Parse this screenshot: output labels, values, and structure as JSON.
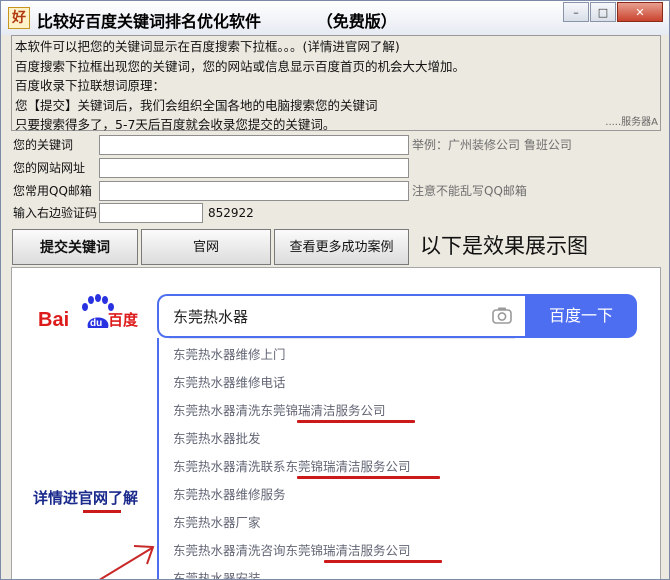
{
  "window": {
    "app_icon_char": "好",
    "title": "比较好百度关键词排名优化软件          （免费版）",
    "controls": {
      "minimize": "–",
      "maximize": "□",
      "close": "✕"
    }
  },
  "info": {
    "lines": [
      "本软件可以把您的关键词显示在百度搜索下拉框。。。(详情进官网了解)",
      "百度搜索下拉框出现您的关键词，您的网站或信息显示百度首页的机会大大增加。",
      "百度收录下拉联想词原理：",
      "您【提交】关键词后，我们会组织全国各地的电脑搜索您的关键词",
      "只要搜索得多了，5-7天后百度就会收录您提交的关键词。"
    ],
    "server_label": ".....服务器A"
  },
  "form": {
    "keyword_label": "您的关键词",
    "keyword_hint": "举例：广州装修公司 鲁班公司",
    "url_label": "您的网站网址",
    "qq_label": "您常用QQ邮箱",
    "qq_hint": "注意不能乱写QQ邮箱",
    "captcha_label": "输入右边验证码",
    "captcha_code": "852922"
  },
  "buttons": {
    "submit": "提交关键词",
    "website": "官网",
    "cases": "查看更多成功案例"
  },
  "effect_title": "以下是效果展示图",
  "demo": {
    "logo_text": {
      "bai": "Bai",
      "du": "du",
      "cn": "百度"
    },
    "query": "东莞热水器",
    "search_button": "百度一下",
    "suggestions": [
      "东莞热水器维修上门",
      "东莞热水器维修电话",
      "东莞热水器清洗东莞锦瑞清洁服务公司",
      "东莞热水器批发",
      "东莞热水器清洗联系东莞锦瑞清洁服务公司",
      "东莞热水器维修服务",
      "东莞热水器厂家",
      "东莞热水器清洗咨询东莞锦瑞清洁服务公司",
      "东莞热水器安装"
    ],
    "details_text": "详情进官网了解",
    "colors": {
      "accent": "#4e6ef2",
      "logo_red": "#de1b1b",
      "logo_blue": "#2932e1",
      "underline": "#cc1a1a"
    }
  }
}
